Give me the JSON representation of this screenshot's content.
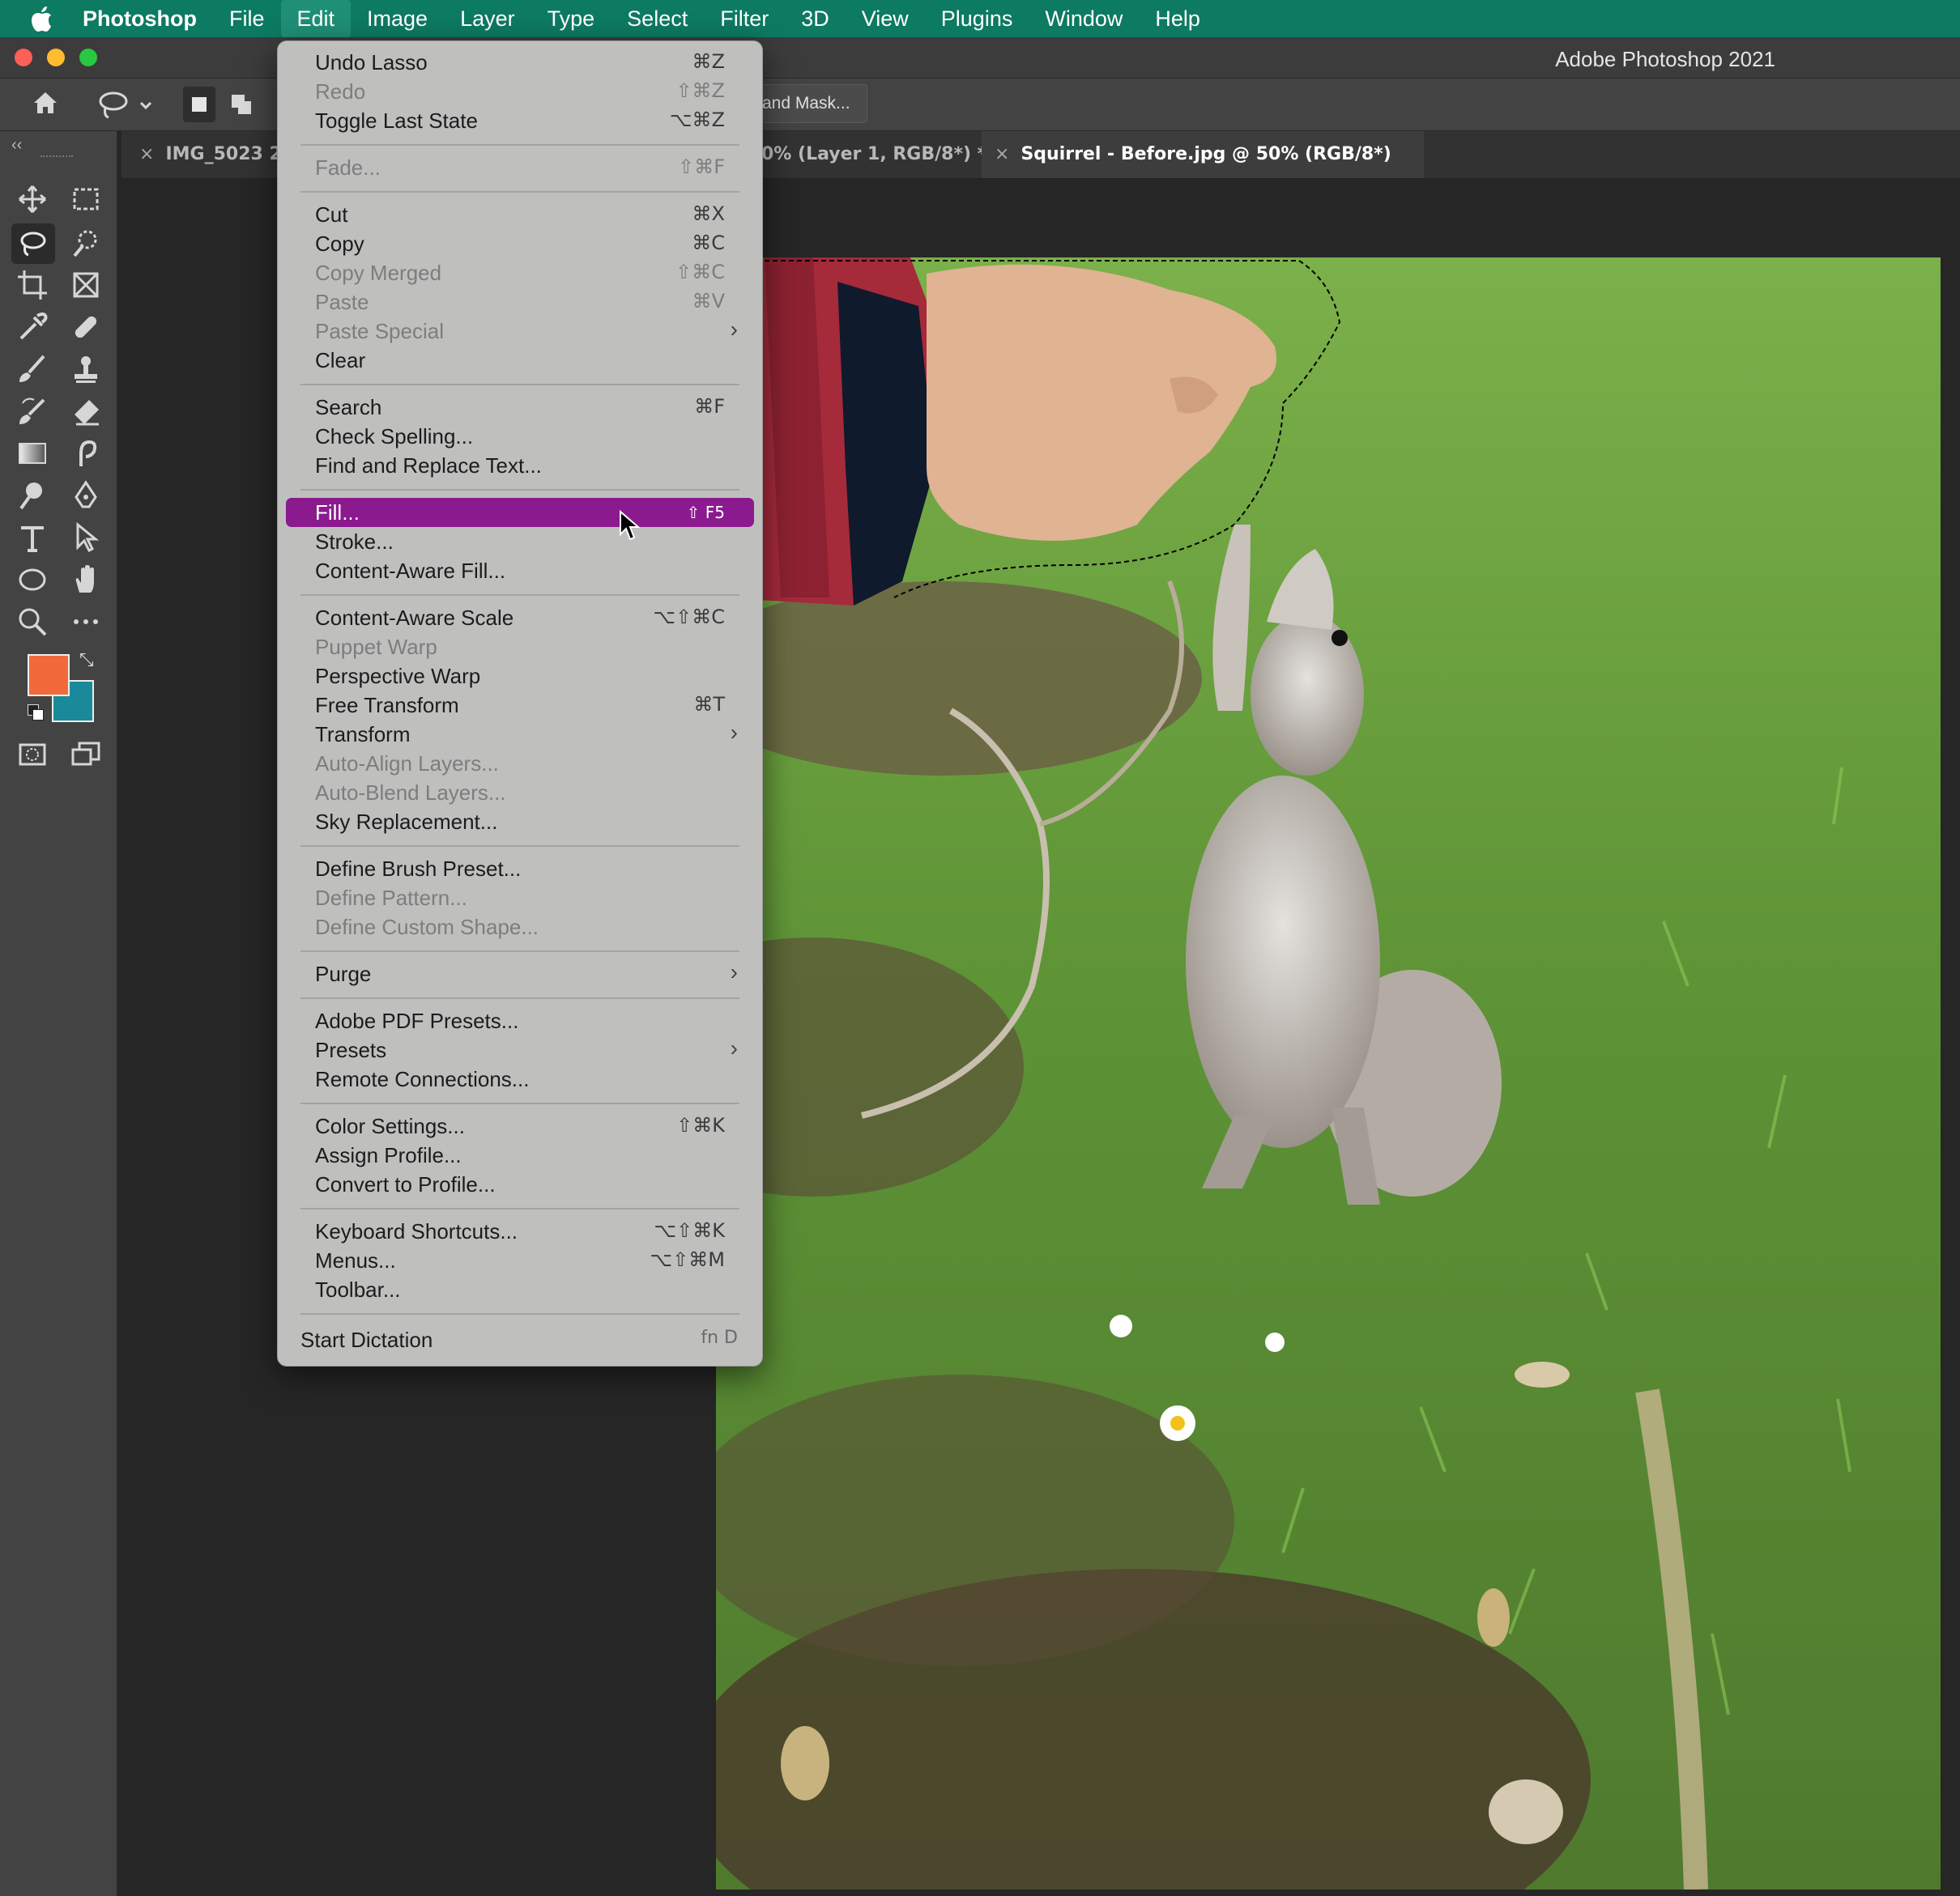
{
  "menubar": {
    "apple_icon": "apple-icon",
    "items": [
      "Photoshop",
      "File",
      "Edit",
      "Image",
      "Layer",
      "Type",
      "Select",
      "Filter",
      "3D",
      "View",
      "Plugins",
      "Window",
      "Help"
    ],
    "active": "Edit",
    "color": "#0d7a62"
  },
  "titlebar": {
    "title": "Adobe Photoshop 2021"
  },
  "options": {
    "mask_button": "and Mask..."
  },
  "tabs": [
    {
      "label": "IMG_5023 2.p"
    },
    {
      "label": "0% (Layer 1, RGB/8*) *"
    },
    {
      "label": "Squirrel - Before.jpg @ 50% (RGB/8*)"
    }
  ],
  "toolbar": {
    "foreground_color": "#f26a3c",
    "background_color": "#1a8a9a"
  },
  "edit_menu": {
    "highlight_color": "#8b1a8f",
    "items": [
      {
        "label": "Undo Lasso",
        "shortcut": "⌘Z"
      },
      {
        "label": "Redo",
        "shortcut": "⇧⌘Z",
        "disabled": true
      },
      {
        "label": "Toggle Last State",
        "shortcut": "⌥⌘Z"
      },
      {
        "label": "Fade...",
        "shortcut": "⇧⌘F",
        "disabled": true
      },
      {
        "label": "Cut",
        "shortcut": "⌘X"
      },
      {
        "label": "Copy",
        "shortcut": "⌘C"
      },
      {
        "label": "Copy Merged",
        "shortcut": "⇧⌘C",
        "disabled": true
      },
      {
        "label": "Paste",
        "shortcut": "⌘V",
        "disabled": true
      },
      {
        "label": "Paste Special",
        "shortcut": "›",
        "disabled": true
      },
      {
        "label": "Clear",
        "shortcut": ""
      },
      {
        "label": "Search",
        "shortcut": "⌘F"
      },
      {
        "label": "Check Spelling...",
        "shortcut": ""
      },
      {
        "label": "Find and Replace Text...",
        "shortcut": ""
      },
      {
        "label": "Fill...",
        "shortcut": "⇧ F5",
        "highlighted": true
      },
      {
        "label": "Stroke...",
        "shortcut": ""
      },
      {
        "label": "Content-Aware Fill...",
        "shortcut": ""
      },
      {
        "label": "Content-Aware Scale",
        "shortcut": "⌥⇧⌘C"
      },
      {
        "label": "Puppet Warp",
        "shortcut": "",
        "disabled": true
      },
      {
        "label": "Perspective Warp",
        "shortcut": ""
      },
      {
        "label": "Free Transform",
        "shortcut": "⌘T"
      },
      {
        "label": "Transform",
        "shortcut": "›"
      },
      {
        "label": "Auto-Align Layers...",
        "shortcut": "",
        "disabled": true
      },
      {
        "label": "Auto-Blend Layers...",
        "shortcut": "",
        "disabled": true
      },
      {
        "label": "Sky Replacement...",
        "shortcut": ""
      },
      {
        "label": "Define Brush Preset...",
        "shortcut": ""
      },
      {
        "label": "Define Pattern...",
        "shortcut": "",
        "disabled": true
      },
      {
        "label": "Define Custom Shape...",
        "shortcut": "",
        "disabled": true
      },
      {
        "label": "Purge",
        "shortcut": "›"
      },
      {
        "label": "Adobe PDF Presets...",
        "shortcut": ""
      },
      {
        "label": "Presets",
        "shortcut": "›"
      },
      {
        "label": "Remote Connections...",
        "shortcut": ""
      },
      {
        "label": "Color Settings...",
        "shortcut": "⇧⌘K"
      },
      {
        "label": "Assign Profile...",
        "shortcut": ""
      },
      {
        "label": "Convert to Profile...",
        "shortcut": ""
      },
      {
        "label": "Keyboard Shortcuts...",
        "shortcut": "⌥⇧⌘K"
      },
      {
        "label": "Menus...",
        "shortcut": "⌥⇧⌘M"
      },
      {
        "label": "Toolbar...",
        "shortcut": ""
      },
      {
        "label": "Start Dictation",
        "shortcut": "fn D"
      }
    ]
  }
}
